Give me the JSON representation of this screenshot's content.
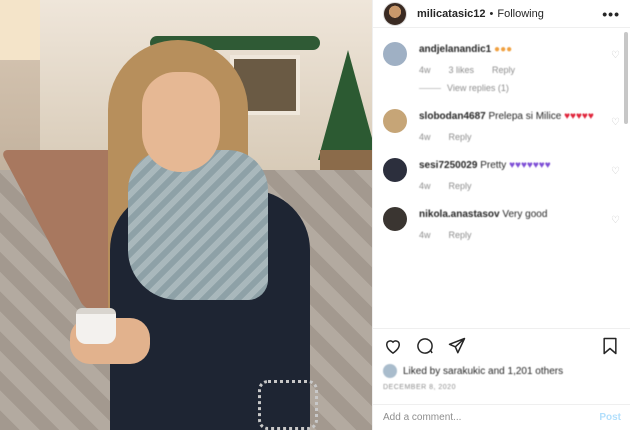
{
  "post": {
    "username": "milicatasic12",
    "separator": "•",
    "follow_status": "Following",
    "more": "•••"
  },
  "comments": [
    {
      "user": "andjelanandic1",
      "text": "",
      "emoji": "●●●",
      "emoji_color": "orange",
      "time": "4w",
      "likes": "3 likes",
      "reply_label": "Reply",
      "view_replies": "View replies (1)",
      "avatar_color": "#9fb0c4"
    },
    {
      "user": "slobodan4687",
      "text": "Prelepa si Milice",
      "emoji": "♥♥♥♥♥",
      "emoji_color": "red",
      "time": "4w",
      "likes": "",
      "reply_label": "Reply",
      "avatar_color": "#c6a577"
    },
    {
      "user": "sesi7250029",
      "text": "Pretty",
      "emoji": "♥♥♥♥♥♥♥",
      "emoji_color": "purple",
      "time": "4w",
      "likes": "",
      "reply_label": "Reply",
      "avatar_color": "#2c2f3d"
    },
    {
      "user": "nikola.anastasov",
      "text": "Very good",
      "emoji": "",
      "emoji_color": "",
      "time": "4w",
      "likes": "",
      "reply_label": "Reply",
      "avatar_color": "#3a3531"
    }
  ],
  "likes": {
    "text": "Liked by sarakukic and 1,201 others"
  },
  "date": "DECEMBER 8, 2020",
  "add_comment": {
    "placeholder": "Add a comment...",
    "post_label": "Post"
  },
  "colors": {
    "link_blue": "#b2dffc",
    "muted_gray": "#8e8e8e",
    "text": "#262626"
  },
  "icons": [
    "heart-icon",
    "comment-icon",
    "share-icon",
    "bookmark-icon",
    "more-icon"
  ]
}
